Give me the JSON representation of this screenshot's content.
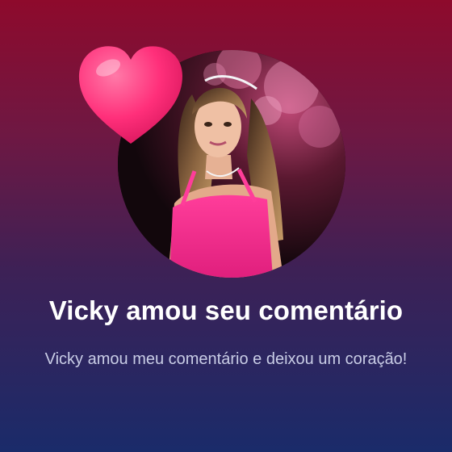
{
  "notification": {
    "title": "Vicky amou seu comentário",
    "message": "Vicky amou meu comentário e deixou um coração!"
  },
  "icons": {
    "reaction": "heart-icon"
  },
  "colors": {
    "background_top": "#8e0a2c",
    "background_bottom": "#1a2b6a",
    "heart": "#ff2f7a",
    "message_text": "#c9cde6"
  }
}
